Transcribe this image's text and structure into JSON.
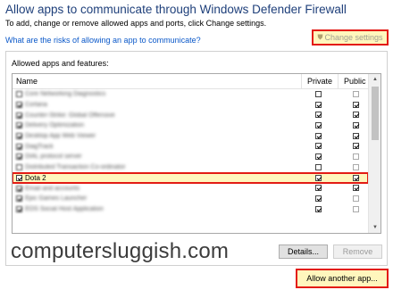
{
  "header": {
    "title": "Allow apps to communicate through Windows Defender Firewall",
    "subtitle": "To add, change or remove allowed apps and ports, click Change settings.",
    "risk_link": "What are the risks of allowing an app to communicate?",
    "change_settings": "Change settings"
  },
  "panel": {
    "label": "Allowed apps and features:",
    "columns": {
      "name": "Name",
      "private": "Private",
      "public": "Public"
    },
    "rows": [
      {
        "name": "Core Networking Diagnostics",
        "checked": false,
        "private": false,
        "public": false,
        "obscured": true
      },
      {
        "name": "Cortana",
        "checked": true,
        "private": true,
        "public": true,
        "obscured": true
      },
      {
        "name": "Counter-Strike: Global Offensive",
        "checked": true,
        "private": true,
        "public": true,
        "obscured": true
      },
      {
        "name": "Delivery Optimization",
        "checked": true,
        "private": true,
        "public": true,
        "obscured": true
      },
      {
        "name": "Desktop App Web Viewer",
        "checked": true,
        "private": true,
        "public": true,
        "obscured": true
      },
      {
        "name": "DiagTrack",
        "checked": true,
        "private": true,
        "public": true,
        "obscured": true
      },
      {
        "name": "DIAL protocol server",
        "checked": true,
        "private": true,
        "public": false,
        "obscured": true
      },
      {
        "name": "Distributed Transaction Co-ordinator",
        "checked": false,
        "private": false,
        "public": false,
        "obscured": true
      },
      {
        "name": "Dota 2",
        "checked": true,
        "private": true,
        "public": true,
        "obscured": false,
        "highlight": true
      },
      {
        "name": "Email and accounts",
        "checked": true,
        "private": true,
        "public": true,
        "obscured": true
      },
      {
        "name": "Epic Games Launcher",
        "checked": true,
        "private": true,
        "public": false,
        "obscured": true
      },
      {
        "name": "EOS Social Host Application",
        "checked": true,
        "private": true,
        "public": false,
        "obscured": true
      }
    ]
  },
  "buttons": {
    "details": "Details...",
    "remove": "Remove",
    "allow_another": "Allow another app..."
  },
  "watermark": "computersluggish.com",
  "colors": {
    "highlight_border": "#e31b14",
    "highlight_fill": "#fff6bd",
    "title": "#1e3f7a",
    "link": "#0a58c9"
  }
}
